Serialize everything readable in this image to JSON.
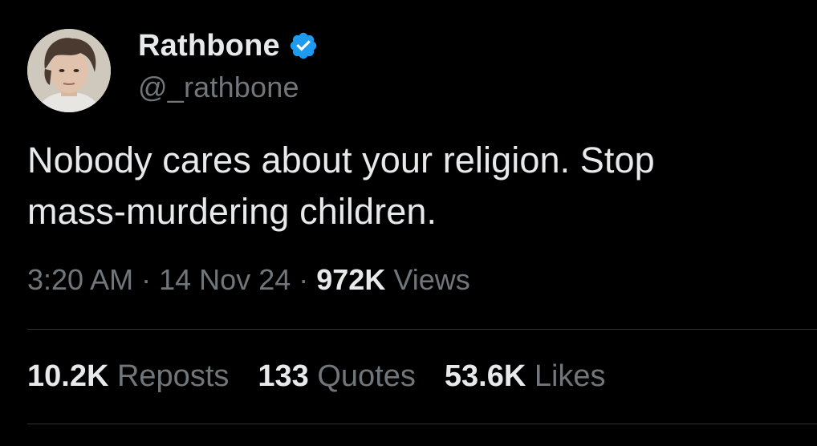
{
  "author": {
    "display_name": "Rathbone",
    "handle": "@_rathbone",
    "verified_color": "#1d9bf0"
  },
  "tweet": {
    "text_line_1": "Nobody cares about your religion. Stop",
    "text_line_2": "mass-murdering children."
  },
  "meta": {
    "time": "3:20 AM",
    "separator": "·",
    "date": "14 Nov 24",
    "views_count": "972K",
    "views_label": "Views"
  },
  "stats": {
    "reposts_count": "10.2K",
    "reposts_label": "Reposts",
    "quotes_count": "133",
    "quotes_label": "Quotes",
    "likes_count": "53.6K",
    "likes_label": "Likes"
  },
  "icons": {
    "verified": "verified-badge-icon",
    "avatar": "profile-photo"
  },
  "colors": {
    "background": "#000000",
    "text_primary": "#e7e9ea",
    "text_secondary": "#71767b",
    "divider": "#2f3336",
    "accent": "#1d9bf0"
  }
}
